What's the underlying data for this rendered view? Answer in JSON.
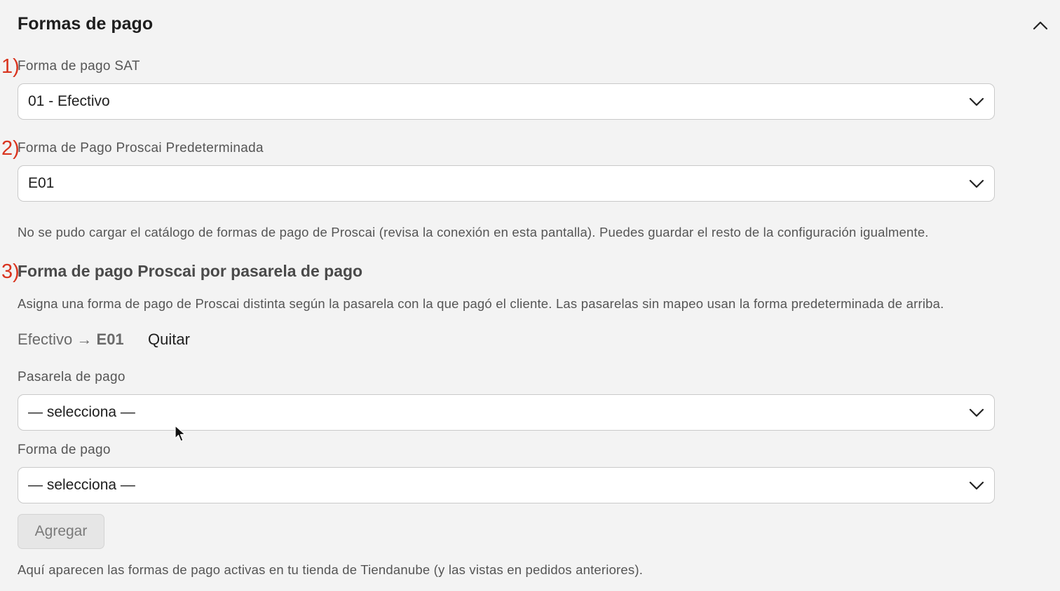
{
  "header": {
    "title": "Formas de pago",
    "collapse_icon": "chevron-up-icon"
  },
  "markers": [
    "1)",
    "2)",
    "3)"
  ],
  "sat_payment": {
    "label": "Forma de pago SAT",
    "selected": "01 - Efectivo"
  },
  "default_proscai": {
    "label": "Forma de Pago Proscai Predeterminada",
    "selected": "E01"
  },
  "catalog_error": "No se pudo cargar el catálogo de formas de pago de Proscai (revisa la conexión en esta pantalla). Puedes guardar el resto de la configuración igualmente.",
  "gateway_mapping": {
    "heading": "Forma de pago Proscai por pasarela de pago",
    "description": "Asigna una forma de pago de Proscai distinta según la pasarela con la que pagó el cliente. Las pasarelas sin mapeo usan la forma predeterminada de arriba.",
    "mappings": [
      {
        "gateway": "Efectivo",
        "arrow": "→",
        "code": "E01",
        "remove_label": "Quitar"
      }
    ],
    "gateway_label": "Pasarela de pago",
    "gateway_selected": "— selecciona —",
    "payment_label": "Forma de pago",
    "payment_selected": "— selecciona —",
    "add_label": "Agregar",
    "footer_note": "Aquí aparecen las formas de pago activas en tu tienda de Tiendanube (y las vistas en pedidos anteriores)."
  },
  "colors": {
    "marker": "#d9341f",
    "background": "#f3f3f3"
  }
}
